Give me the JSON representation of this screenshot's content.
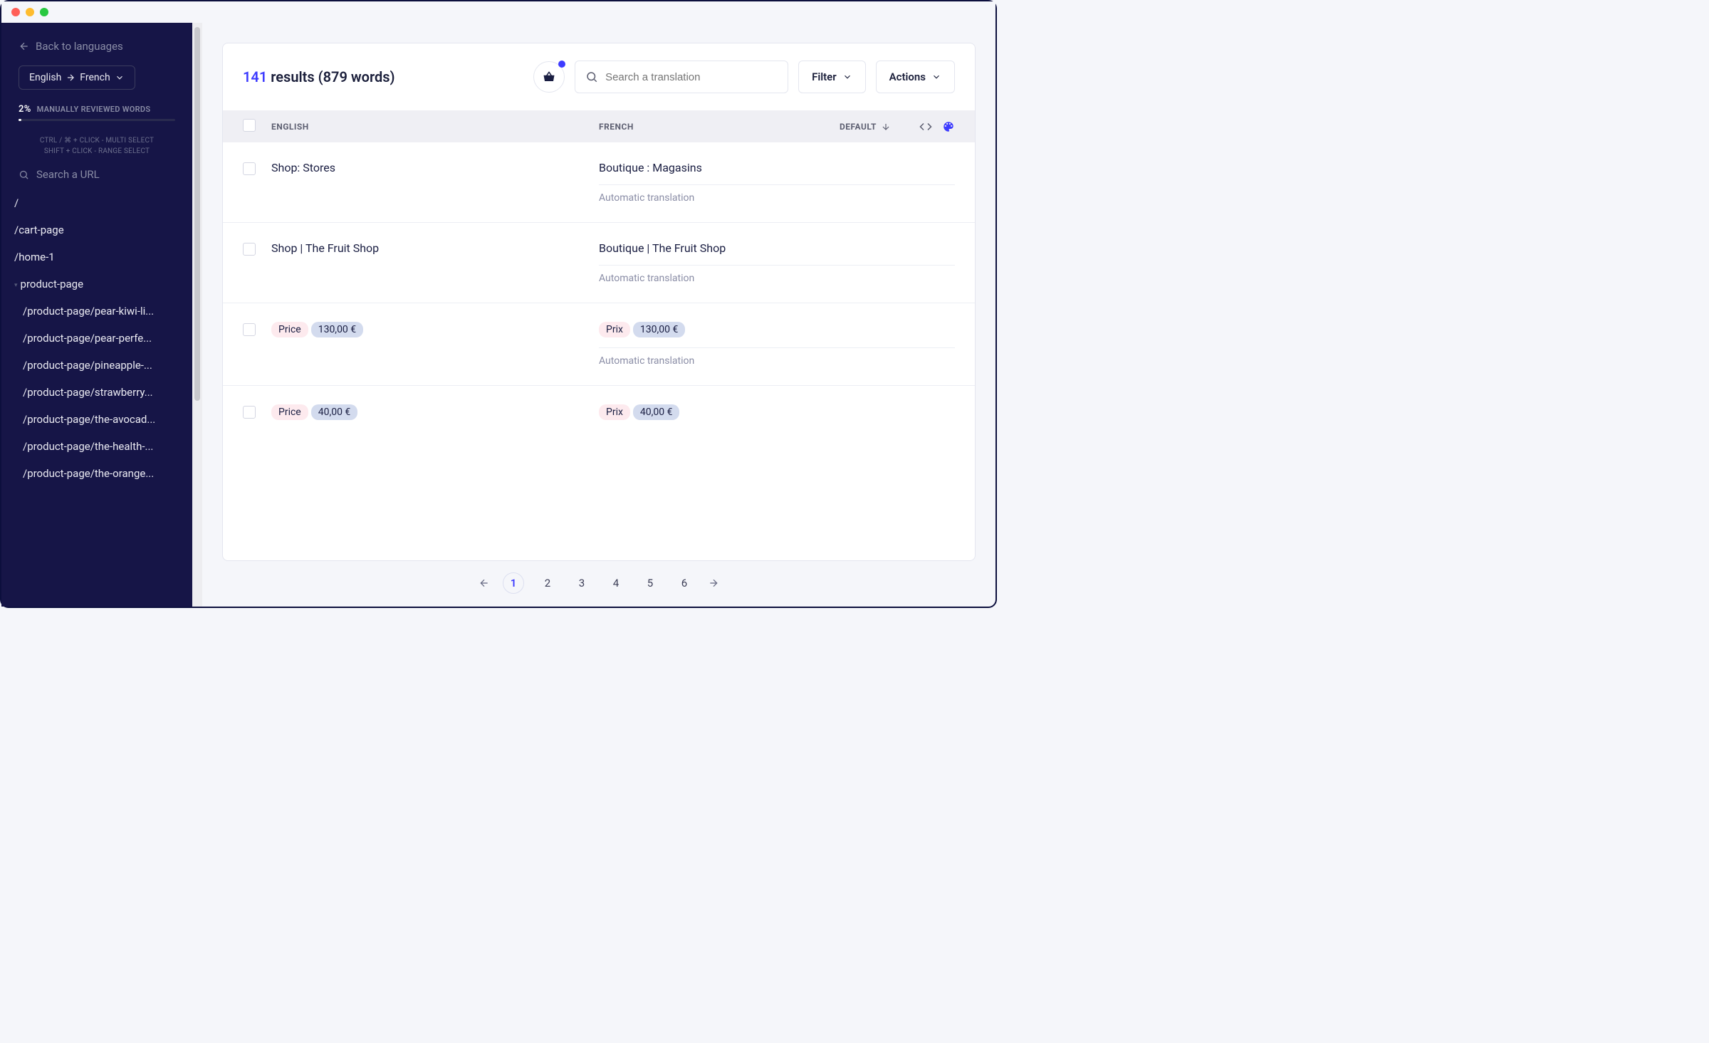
{
  "sidebar": {
    "back_label": "Back to languages",
    "lang_from": "English",
    "lang_to": "French",
    "progress_pct": "2%",
    "progress_label": "MANUALLY REVIEWED WORDS",
    "hint1": "CTRL / ⌘ + CLICK - MULTI SELECT",
    "hint2": "SHIFT + CLICK - RANGE SELECT",
    "url_search_placeholder": "Search a URL",
    "urls": [
      "/",
      "/cart-page",
      "/home-1",
      "product-page",
      "/product-page/pear-kiwi-li...",
      "/product-page/pear-perfe...",
      "/product-page/pineapple-...",
      "/product-page/strawberry...",
      "/product-page/the-avocad...",
      "/product-page/the-health-...",
      "/product-page/the-orange..."
    ]
  },
  "header": {
    "count": "141",
    "results_word": "results",
    "words_paren": "(879 words)",
    "search_placeholder": "Search a translation",
    "filter_label": "Filter",
    "actions_label": "Actions"
  },
  "table": {
    "col_en": "ENGLISH",
    "col_fr": "FRENCH",
    "col_default": "DEFAULT"
  },
  "rows": [
    {
      "en_plain": "Shop: Stores",
      "fr_plain": "Boutique : Magasins",
      "auto": "Automatic translation"
    },
    {
      "en_plain": "Shop | The Fruit Shop",
      "fr_plain": "Boutique | The Fruit Shop",
      "auto": "Automatic translation"
    },
    {
      "en_label": "Price",
      "en_value": "130,00 €",
      "fr_label": "Prix",
      "fr_value": "130,00 €",
      "auto": "Automatic translation"
    },
    {
      "en_label": "Price",
      "en_value": "40,00 €",
      "fr_label": "Prix",
      "fr_value": "40,00 €"
    }
  ],
  "pagination": {
    "pages": [
      "1",
      "2",
      "3",
      "4",
      "5",
      "6"
    ],
    "active": "1"
  }
}
